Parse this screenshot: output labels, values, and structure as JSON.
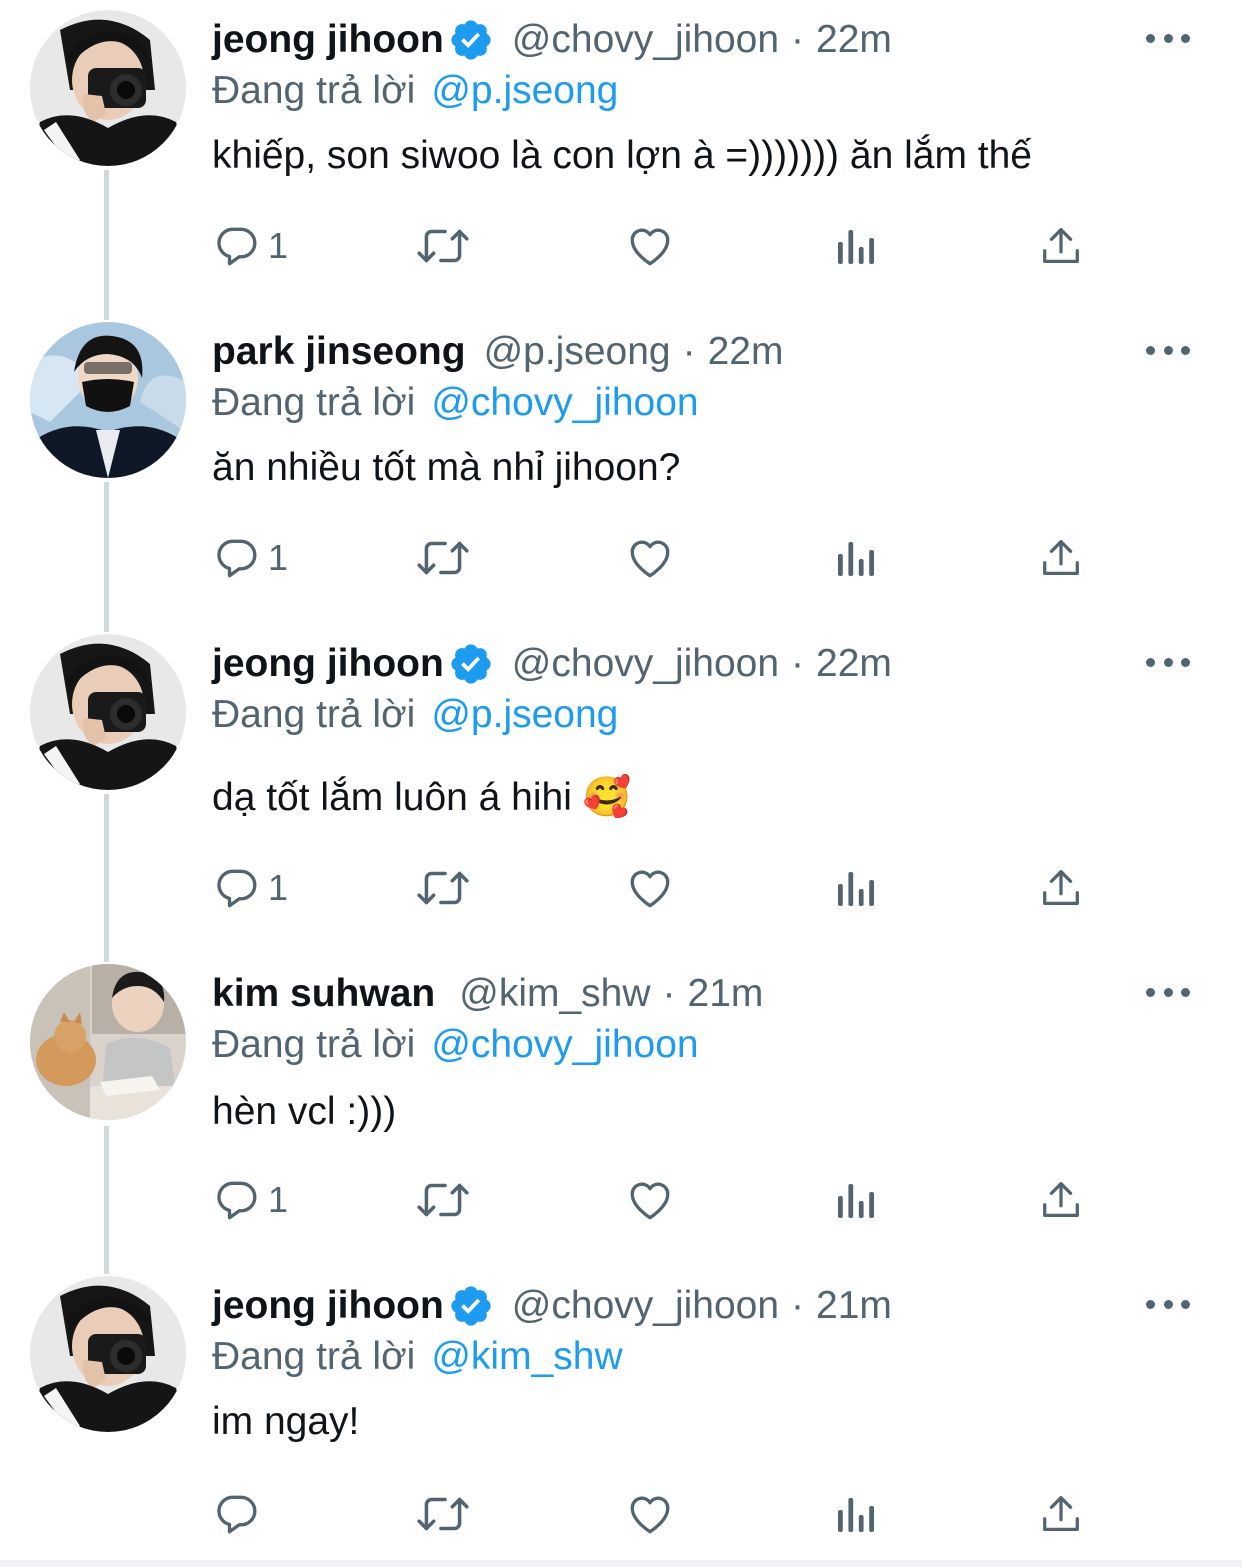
{
  "colors": {
    "primary_text": "#0f1419",
    "secondary_text": "#536471",
    "accent": "#1d9bf0",
    "thread_line": "#cfd9de"
  },
  "reply_prefix": "Đang trả lời",
  "icons": {
    "reply": "reply-bubble-icon",
    "retweet": "retweet-icon",
    "like": "heart-icon",
    "views": "views-bar-chart-icon",
    "share": "share-upload-icon",
    "more": "more-dots-icon",
    "verified": "verified-badge-icon"
  },
  "tweets": [
    {
      "name": "jeong jihoon",
      "verified": true,
      "handle": "@chovy_jihoon",
      "separator": "·",
      "time": "22m",
      "reply_to": "@p.jseong",
      "text": "khiếp, son siwoo là con lợn à =))))))) ăn lắm thế",
      "reply_count": "1"
    },
    {
      "name": "park jinseong",
      "verified": false,
      "handle": "@p.jseong",
      "separator": "·",
      "time": "22m",
      "reply_to": "@chovy_jihoon",
      "text": "ăn nhiều tốt mà nhỉ jihoon?",
      "reply_count": "1"
    },
    {
      "name": "jeong jihoon",
      "verified": true,
      "handle": "@chovy_jihoon",
      "separator": "·",
      "time": "22m",
      "reply_to": "@p.jseong",
      "text": "dạ tốt lắm luôn á hihi 🥰",
      "reply_count": "1"
    },
    {
      "name": "kim suhwan",
      "verified": false,
      "handle": "@kim_shw",
      "separator": "·",
      "time": "21m",
      "reply_to": "@chovy_jihoon",
      "text": "hèn vcl :)))",
      "reply_count": "1"
    },
    {
      "name": "jeong jihoon",
      "verified": true,
      "handle": "@chovy_jihoon",
      "separator": "·",
      "time": "21m",
      "reply_to": "@kim_shw",
      "text": "im ngay!",
      "reply_count": ""
    }
  ]
}
